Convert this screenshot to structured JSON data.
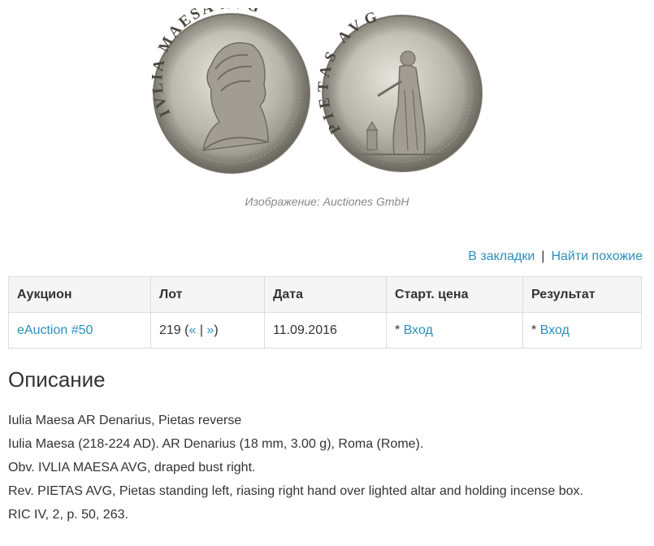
{
  "image": {
    "obverse_legend": "IVLIA MAESA AVG",
    "reverse_legend": "PIETAS AVG",
    "caption": "Изображение: Auctiones GmbH"
  },
  "actions": {
    "bookmark": "В закладки",
    "separator": "|",
    "find_similar": "Найти похожие"
  },
  "table": {
    "headers": [
      "Аукцион",
      "Лот",
      "Дата",
      "Старт. цена",
      "Результат"
    ],
    "row": {
      "auction": "eAuction #50",
      "lot_number": "219",
      "lot_open": "(",
      "lot_prev": "«",
      "lot_sep": "|",
      "lot_next": "»",
      "lot_close": ")",
      "date": "11.09.2016",
      "start_star": "*",
      "start_link": "Вход",
      "result_star": "*",
      "result_link": "Вход"
    }
  },
  "description": {
    "title": "Описание",
    "lines": [
      "Iulia Maesa AR Denarius, Pietas reverse",
      "Iulia Maesa (218-224 AD). AR Denarius (18 mm, 3.00 g), Roma (Rome).",
      "Obv. IVLIA MAESA AVG, draped bust right.",
      "Rev. PIETAS AVG, Pietas standing left, riasing right hand over lighted altar and holding incense box.",
      "RIC IV, 2, p. 50, 263."
    ]
  },
  "colors": {
    "link": "#2a8fbd",
    "text": "#333333",
    "caption": "#888888",
    "header_bg": "#f5f5f5",
    "border": "#dddddd"
  }
}
